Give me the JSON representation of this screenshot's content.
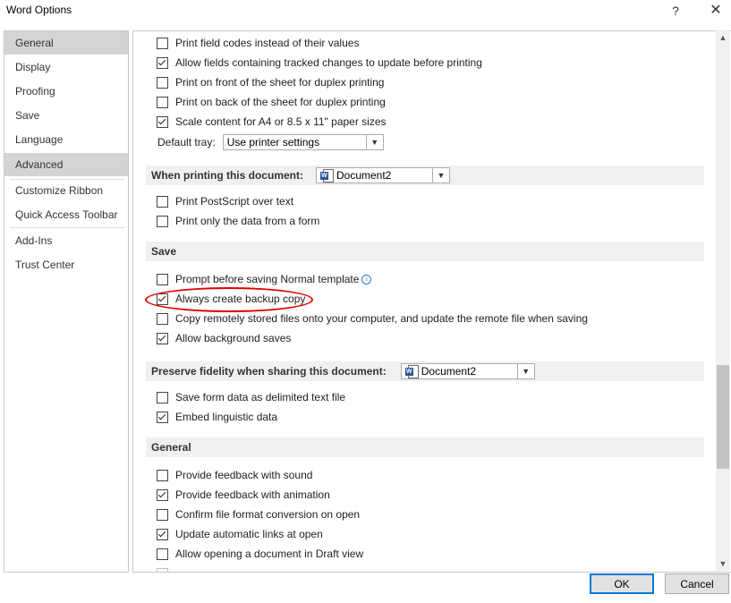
{
  "window": {
    "title": "Word Options",
    "help_glyph": "?",
    "close_glyph": "✕"
  },
  "sidebar": {
    "items": [
      {
        "label": "General"
      },
      {
        "label": "Display"
      },
      {
        "label": "Proofing"
      },
      {
        "label": "Save"
      },
      {
        "label": "Language"
      },
      {
        "label": "Advanced"
      },
      {
        "label": "Customize Ribbon"
      },
      {
        "label": "Quick Access Toolbar"
      },
      {
        "label": "Add-Ins"
      },
      {
        "label": "Trust Center"
      }
    ]
  },
  "printing": {
    "options": [
      {
        "label": "Print field codes instead of their values",
        "checked": false
      },
      {
        "label": "Allow fields containing tracked changes to update before printing",
        "checked": true
      },
      {
        "label": "Print on front of the sheet for duplex printing",
        "checked": false
      },
      {
        "label": "Print on back of the sheet for duplex printing",
        "checked": false
      },
      {
        "label": "Scale content for A4 or 8.5 x 11\" paper sizes",
        "checked": true
      }
    ],
    "default_tray_label": "Default tray:",
    "default_tray_value": "Use printer settings"
  },
  "when_printing": {
    "header": "When printing this document:",
    "document": "Document2",
    "options": [
      {
        "label": "Print PostScript over text",
        "checked": false
      },
      {
        "label": "Print only the data from a form",
        "checked": false
      }
    ]
  },
  "save": {
    "header": "Save",
    "options": [
      {
        "label": "Prompt before saving Normal template",
        "checked": false
      },
      {
        "label": "Always create backup copy",
        "checked": true
      },
      {
        "label": "Copy remotely stored files onto your computer, and update the remote file when saving",
        "checked": false
      },
      {
        "label": "Allow background saves",
        "checked": true
      }
    ]
  },
  "fidelity": {
    "header": "Preserve fidelity when sharing this document:",
    "document": "Document2",
    "options": [
      {
        "label": "Save form data as delimited text file",
        "checked": false
      },
      {
        "label": "Embed linguistic data",
        "checked": true
      }
    ]
  },
  "general": {
    "header": "General",
    "options": [
      {
        "label": "Provide feedback with sound",
        "checked": false
      },
      {
        "label": "Provide feedback with animation",
        "checked": true
      },
      {
        "label": "Confirm file format conversion on open",
        "checked": false
      },
      {
        "label": "Update automatic links at open",
        "checked": true
      },
      {
        "label": "Allow opening a document in Draft view",
        "checked": false
      }
    ]
  },
  "buttons": {
    "ok": "OK",
    "cancel": "Cancel"
  },
  "icons": {
    "word_doc": "word-document-icon",
    "info": "info-icon",
    "dropdown": "chevron-down-icon"
  },
  "colors": {
    "annotation": "#e00000",
    "selected_nav": "#d4d4d4",
    "section_bg": "#f0f0f0"
  }
}
